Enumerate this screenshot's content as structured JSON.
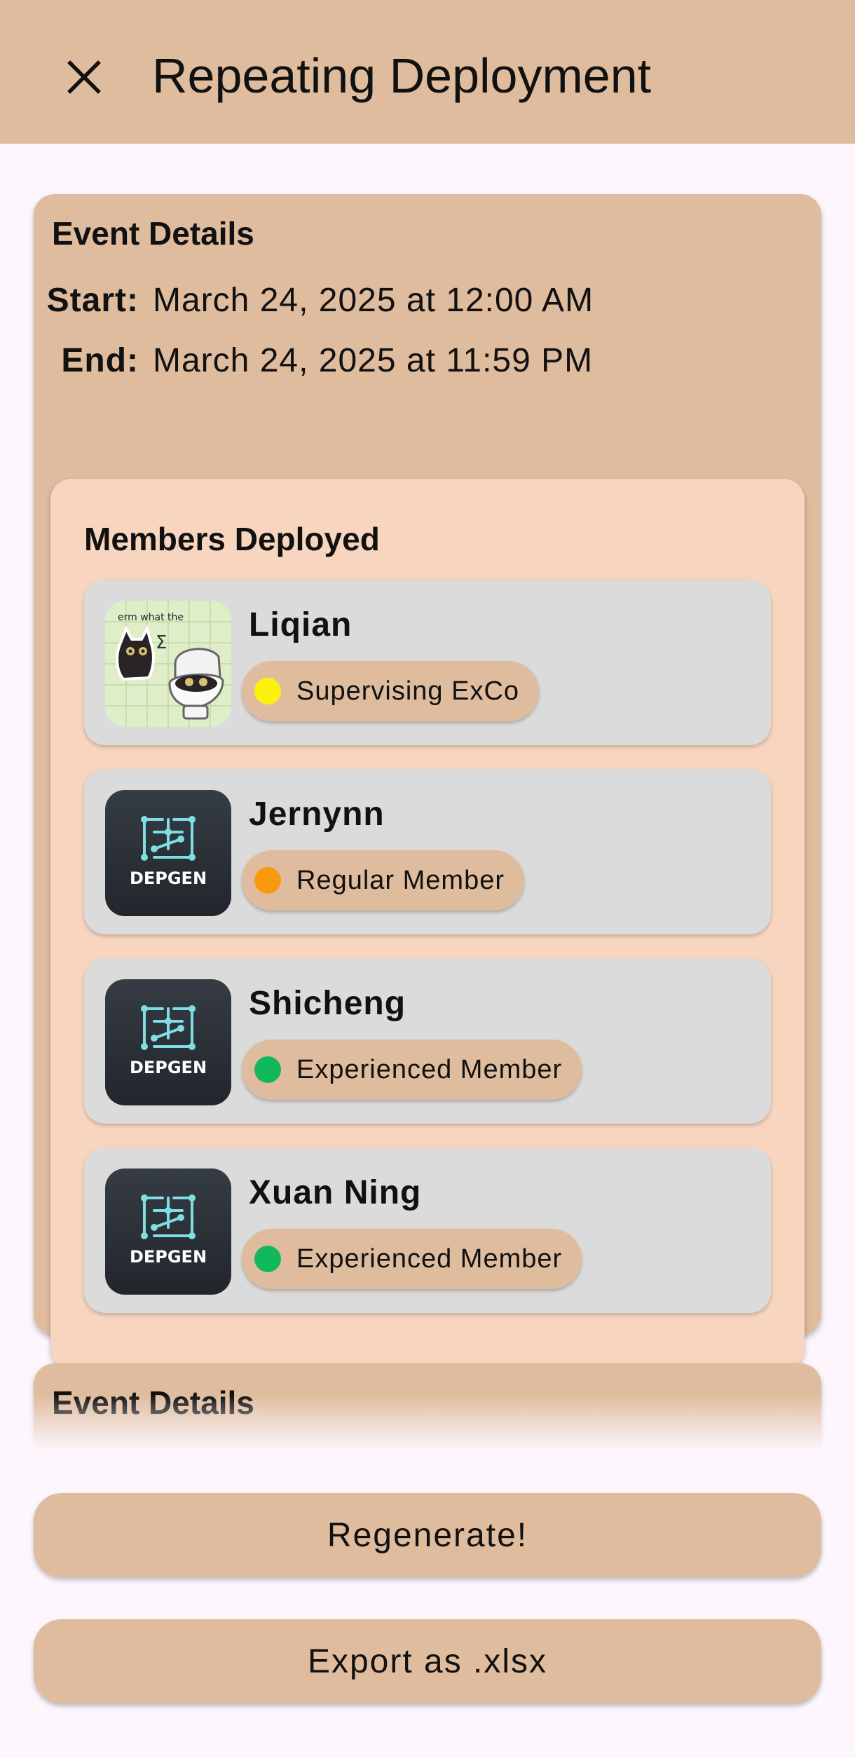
{
  "appbar": {
    "close_icon": "close-icon",
    "title": "Repeating Deployment"
  },
  "events": [
    {
      "heading": "Event Details",
      "start_label": "Start:",
      "start_value": "March 24, 2025 at 12:00 AM",
      "end_label": "End:",
      "end_value": "March 24, 2025 at 11:59 PM",
      "members_heading": "Members Deployed",
      "members": [
        {
          "name": "Liqian",
          "role": "Supervising ExCo",
          "role_color": "#fcf20e",
          "avatar": "cat-sticker-avatar",
          "avatar_caption": "erm what the"
        },
        {
          "name": "Jernynn",
          "role": "Regular Member",
          "role_color": "#f79a0f",
          "avatar": "depgen-logo-avatar",
          "avatar_caption": "DEPGEN"
        },
        {
          "name": "Shicheng",
          "role": "Experienced Member",
          "role_color": "#12b85c",
          "avatar": "depgen-logo-avatar",
          "avatar_caption": "DEPGEN"
        },
        {
          "name": "Xuan Ning",
          "role": "Experienced Member",
          "role_color": "#12b85c",
          "avatar": "depgen-logo-avatar",
          "avatar_caption": "DEPGEN"
        }
      ]
    },
    {
      "heading": "Event Details"
    }
  ],
  "actions": {
    "regenerate_label": "Regenerate!",
    "export_label": "Export as .xlsx"
  },
  "colors": {
    "appbar": "#e0bc9e",
    "card": "#e0bc9e",
    "members_panel": "#f8d5be",
    "member_row": "#dbdbdb",
    "background": "#fdf7fd"
  }
}
